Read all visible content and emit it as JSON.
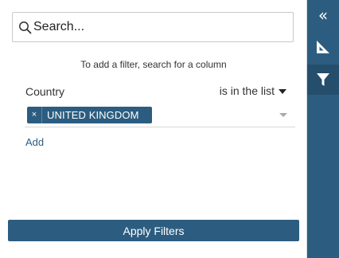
{
  "search": {
    "placeholder": "Search..."
  },
  "hint": "To add a filter, search for a column",
  "filter": {
    "column": "Country",
    "operator": "is in the list",
    "values": [
      "UNITED KINGDOM"
    ],
    "remove_symbol": "×",
    "add_label": "Add"
  },
  "apply_label": "Apply Filters",
  "sidebar": {
    "items": [
      {
        "icon": "double-chevron-left-icon",
        "symbol": "«"
      },
      {
        "icon": "set-square-icon"
      },
      {
        "icon": "filter-icon",
        "active": true
      }
    ]
  },
  "colors": {
    "accent": "#2c5d80",
    "accent_dark": "#244e6c",
    "text": "#333333"
  }
}
